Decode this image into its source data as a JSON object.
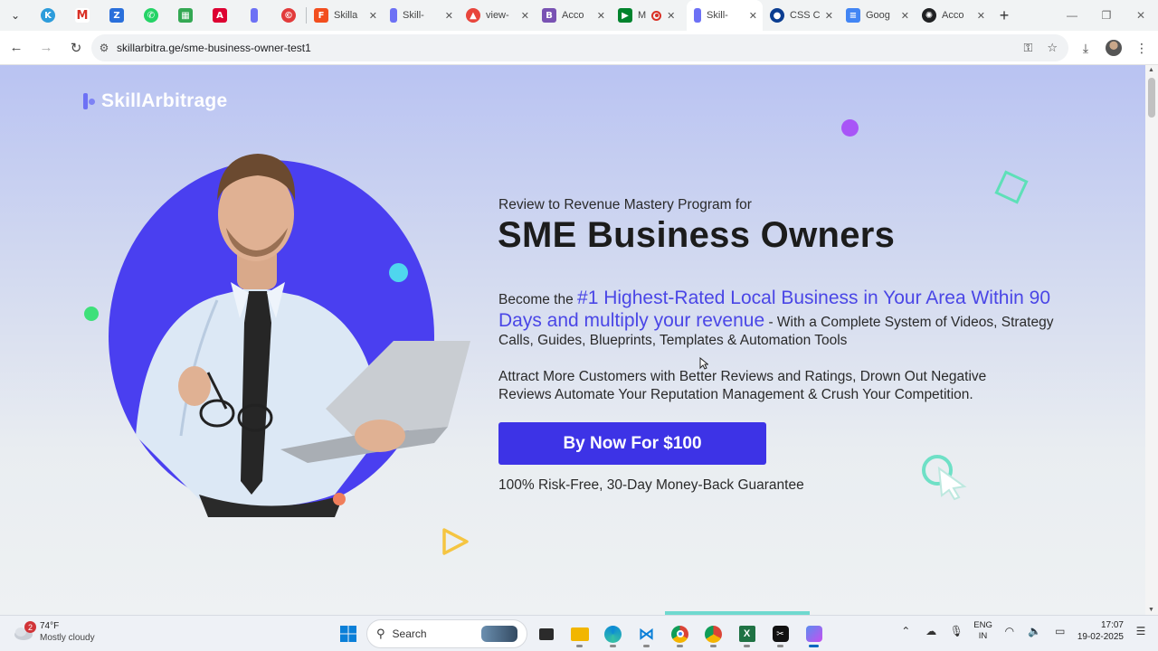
{
  "browser": {
    "tabs": [
      {
        "title": "Skilla",
        "favicon": "figma-icon",
        "color": "#f24e1e"
      },
      {
        "title": "Skill-",
        "favicon": "skillarbitrage-icon",
        "color": "#6d71f5"
      },
      {
        "title": "view-",
        "favicon": "flame-icon",
        "color": "#e8453c"
      },
      {
        "title": "Acco",
        "favicon": "bootstrap-icon",
        "color": "#7952b3"
      },
      {
        "title": "M",
        "favicon": "meet-icon",
        "color": "#00832d"
      },
      {
        "title": "Skill-",
        "favicon": "skillarbitrage-icon",
        "color": "#6d71f5"
      },
      {
        "title": "CSS C",
        "favicon": "globe-icon",
        "color": "#0b3d91"
      },
      {
        "title": "Goog",
        "favicon": "google-docs-icon",
        "color": "#4285f4"
      },
      {
        "title": "Acco",
        "favicon": "openai-icon",
        "color": "#202123"
      }
    ],
    "active_tab_index": 5,
    "url": "skillarbitra.ge/sme-business-owner-test1"
  },
  "page": {
    "logo_text": "SkillArbitrage",
    "kicker": "Review to Revenue Mastery Program for",
    "headline": "SME Business Owners",
    "para1_prefix": "Become the ",
    "para1_highlight": "#1 Highest-Rated Local Business in Your Area Within 90 Days and multiply your revenue",
    "para1_suffix": " - With a Complete System of Videos, Strategy Calls, Guides, Blueprints, Templates & Automation Tools",
    "para2": "Attract More Customers with Better Reviews and Ratings, Drown Out Negative Reviews Automate Your Reputation Management & Crush Your Competition.",
    "cta_label": "By Now For $100",
    "guarantee": "100% Risk-Free, 30-Day Money-Back Guarantee",
    "colors": {
      "accent": "#3d33e6",
      "highlight": "#4a46e6",
      "circle": "#4a3ff0"
    }
  },
  "taskbar": {
    "weather_temp": "74°F",
    "weather_condition": "Mostly cloudy",
    "weather_badge": "2",
    "search_label": "Search",
    "language_top": "ENG",
    "language_bottom": "IN",
    "time": "17:07",
    "date": "19-02-2025"
  }
}
